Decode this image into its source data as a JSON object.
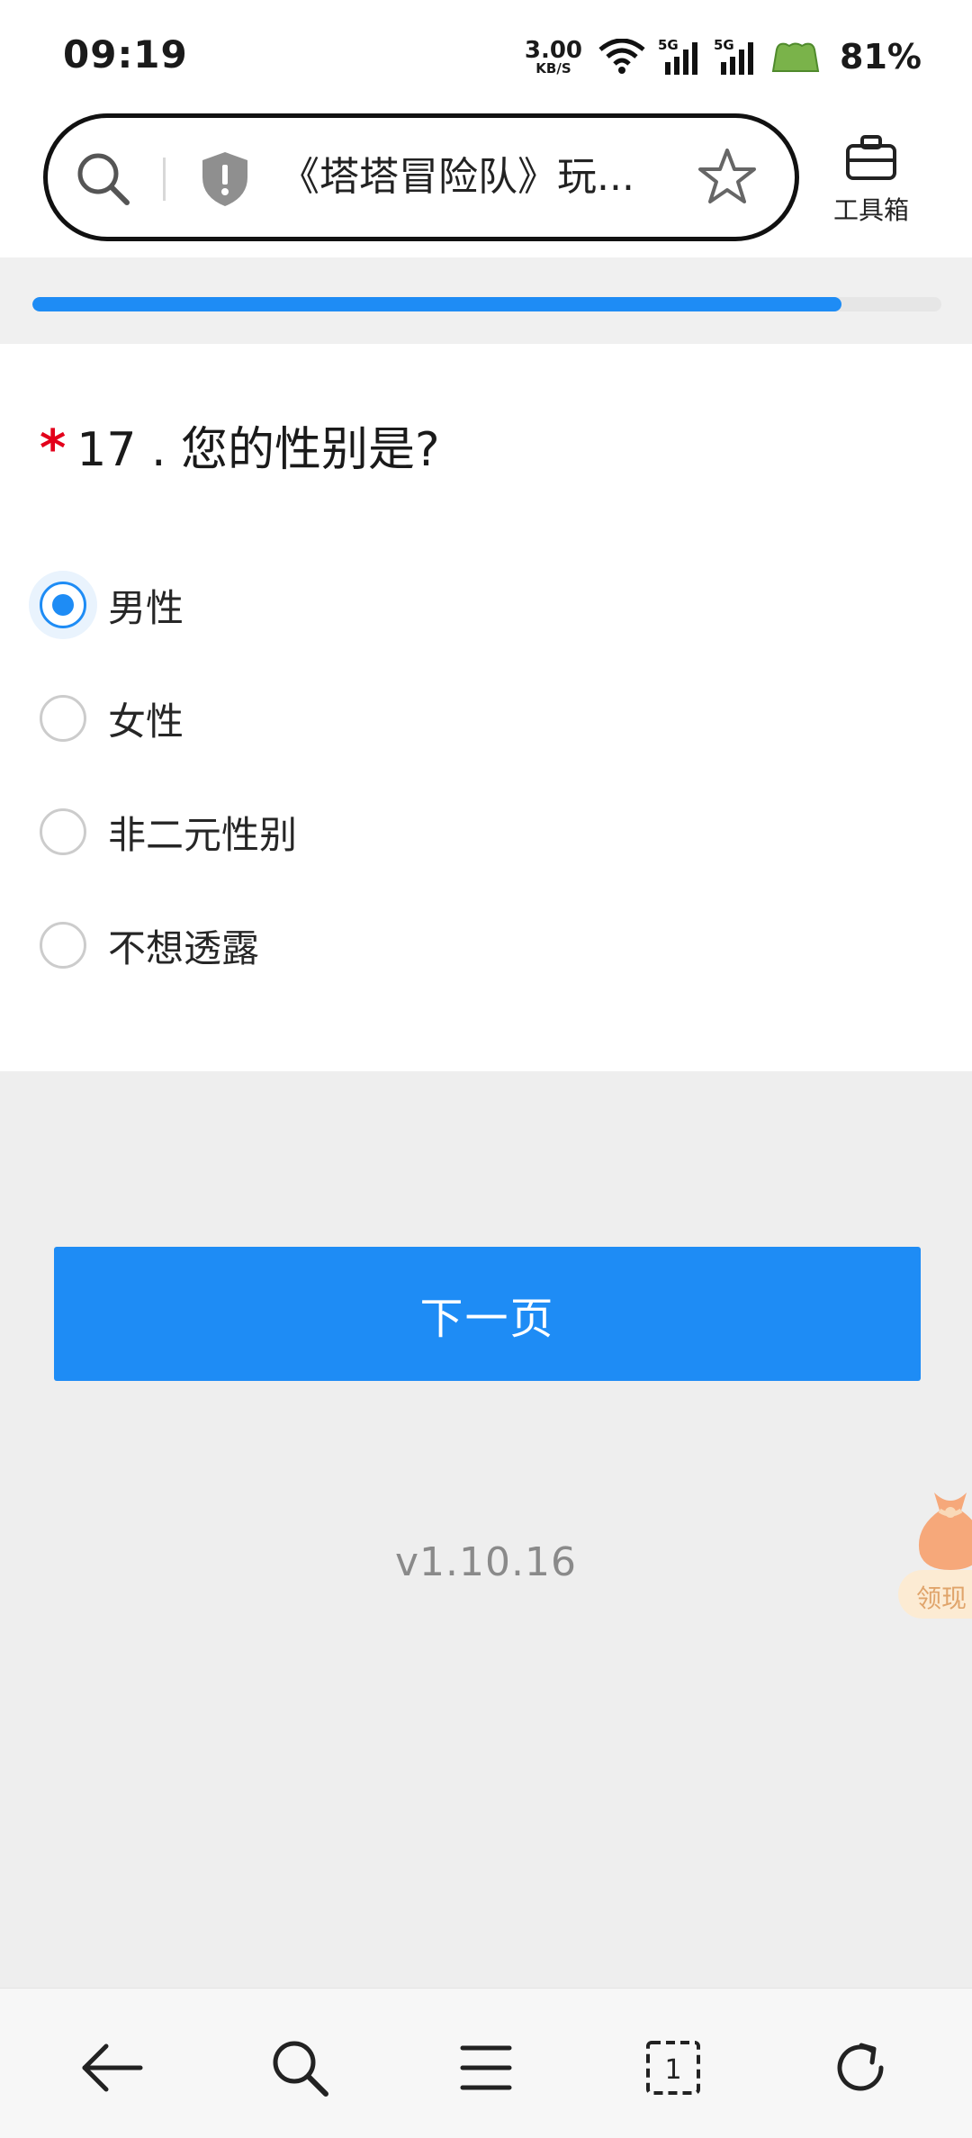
{
  "status_bar": {
    "time": "09:19",
    "net_speed_value": "3.00",
    "net_speed_unit": "KB/S",
    "signal_1": "5G",
    "signal_2": "5G",
    "battery_percent": "81%",
    "icons": [
      "wifi-icon",
      "signal-5g-icon",
      "signal-5g-icon",
      "battery-icon"
    ]
  },
  "browser": {
    "page_title": "《塔塔冒险队》玩...",
    "toolbox_label": "工具箱",
    "icons": [
      "search-icon",
      "shield-warning-icon",
      "star-icon",
      "toolbox-icon"
    ]
  },
  "progress": {
    "fraction": 0.89,
    "color": "#1e8cf5"
  },
  "question": {
    "required_mark": "*",
    "title": "17 . 您的性别是?",
    "options": [
      {
        "label": "男性",
        "selected": true
      },
      {
        "label": "女性",
        "selected": false
      },
      {
        "label": "非二元性别",
        "selected": false
      },
      {
        "label": "不想透露",
        "selected": false
      }
    ]
  },
  "next_button_label": "下一页",
  "version": "v1.10.16",
  "reward_float": {
    "label": "领现",
    "icon": "reward-bag-icon"
  },
  "bottom_nav": {
    "icons": [
      "back-arrow-icon",
      "search-icon",
      "menu-icon",
      "tabs-icon",
      "refresh-icon"
    ],
    "tab_count": "1"
  },
  "colors": {
    "accent": "#1e8cf5",
    "required": "#e3001b",
    "page_bg": "#eeeeee"
  }
}
